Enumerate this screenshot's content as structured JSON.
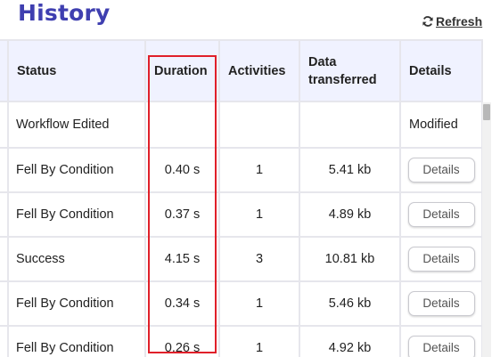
{
  "header": {
    "title": "History",
    "refresh_label": "Refresh"
  },
  "table": {
    "columns": [
      "Status",
      "Duration",
      "Activities",
      "Data\ntransferred",
      "Details"
    ],
    "rows": [
      {
        "status": "Workflow Edited",
        "duration": "",
        "activities": "",
        "data": "",
        "details": "Modified"
      },
      {
        "status": "Fell By Condition",
        "duration": "0.40 s",
        "activities": "1",
        "data": "5.41 kb",
        "details": "Details"
      },
      {
        "status": "Fell By Condition",
        "duration": "0.37 s",
        "activities": "1",
        "data": "4.89 kb",
        "details": "Details"
      },
      {
        "status": "Success",
        "duration": "4.15 s",
        "activities": "3",
        "data": "10.81 kb",
        "details": "Details"
      },
      {
        "status": "Fell By Condition",
        "duration": "0.34 s",
        "activities": "1",
        "data": "5.46 kb",
        "details": "Details"
      },
      {
        "status": "Fell By Condition",
        "duration": "0.26 s",
        "activities": "1",
        "data": "4.92 kb",
        "details": "Details"
      }
    ]
  },
  "colors": {
    "title": "#3f3fb0",
    "header_bg": "#f0f2ff",
    "highlight": "#e0202a"
  },
  "icons": {
    "refresh": "refresh-icon"
  }
}
